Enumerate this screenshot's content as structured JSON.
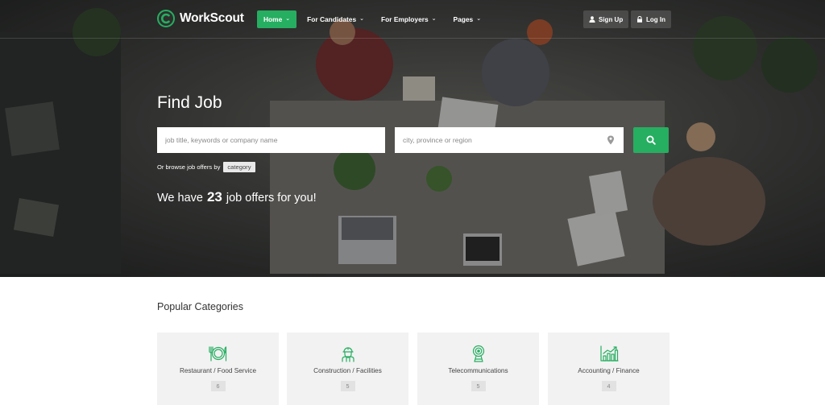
{
  "brand": {
    "name": "WorkScout",
    "accent": "#26ae61"
  },
  "nav": {
    "items": [
      {
        "label": "Home",
        "active": true
      },
      {
        "label": "For Candidates",
        "active": false
      },
      {
        "label": "For Employers",
        "active": false
      },
      {
        "label": "Pages",
        "active": false
      }
    ],
    "sign_up": "Sign Up",
    "log_in": "Log In"
  },
  "hero": {
    "title": "Find Job",
    "keyword_placeholder": "job title, keywords or company name",
    "location_placeholder": "city, province or region",
    "browse_text": "Or browse job offers by",
    "browse_link": "category",
    "offers_prefix": "We have",
    "offers_count": "23",
    "offers_suffix": "job offers for you!"
  },
  "categories": {
    "title": "Popular Categories",
    "items": [
      {
        "label": "Restaurant / Food Service",
        "count": "6",
        "icon": "dining-icon"
      },
      {
        "label": "Construction / Facilities",
        "count": "5",
        "icon": "construction-worker-icon"
      },
      {
        "label": "Telecommunications",
        "count": "5",
        "icon": "radio-tower-icon"
      },
      {
        "label": "Accounting / Finance",
        "count": "4",
        "icon": "growth-chart-icon"
      }
    ]
  }
}
